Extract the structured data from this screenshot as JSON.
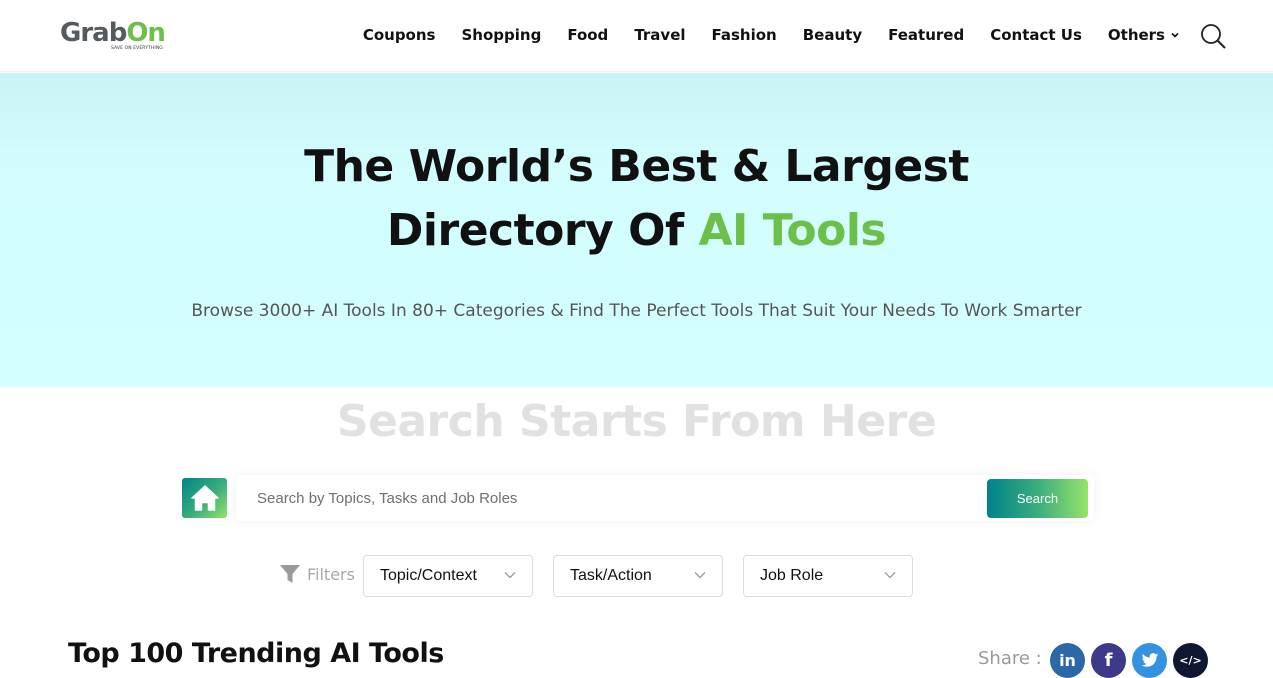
{
  "header": {
    "logo": {
      "text_main": "Grab",
      "text_accent": "On",
      "tagline": "SAVE ON EVERYTHING"
    },
    "nav": [
      {
        "label": "Coupons"
      },
      {
        "label": "Shopping"
      },
      {
        "label": "Food"
      },
      {
        "label": "Travel"
      },
      {
        "label": "Fashion"
      },
      {
        "label": "Beauty"
      },
      {
        "label": "Featured"
      },
      {
        "label": "Contact Us"
      },
      {
        "label": "Others",
        "icon": "chevron-down-icon"
      }
    ],
    "search_icon": "search-icon"
  },
  "hero": {
    "title_line1": "The World’s Best & Largest",
    "title_line2_prefix": "Directory Of ",
    "title_line2_accent": "AI Tools",
    "subtitle": "Browse 3000+ AI Tools In 80+ Categories & Find The Perfect Tools That Suit Your Needs To Work Smarter"
  },
  "search": {
    "heading": "Search Starts From Here",
    "home_icon": "home-icon",
    "placeholder": "Search by Topics, Tasks and Job Roles",
    "value": "",
    "button_label": "Search"
  },
  "filters": {
    "label": "Filters",
    "icon": "filter-icon",
    "selects": [
      {
        "value": "Topic/Context"
      },
      {
        "value": "Task/Action"
      },
      {
        "value": "Job Role"
      }
    ]
  },
  "trending": {
    "title": "Top 100 Trending AI Tools",
    "share_label": "Share :",
    "share_buttons": [
      {
        "name": "linkedin",
        "glyph": "in",
        "color": "#2c68a8"
      },
      {
        "name": "facebook",
        "glyph": "f",
        "color": "#3d3a8a"
      },
      {
        "name": "twitter",
        "glyph": "",
        "color": "#3592e0"
      },
      {
        "name": "embed",
        "glyph": "</>",
        "color": "#111633"
      }
    ]
  },
  "colors": {
    "accent_green": "#6cc04a",
    "hero_bg": "#d3ffff",
    "gradient_start": "#00828a",
    "gradient_end": "#95e36a"
  }
}
